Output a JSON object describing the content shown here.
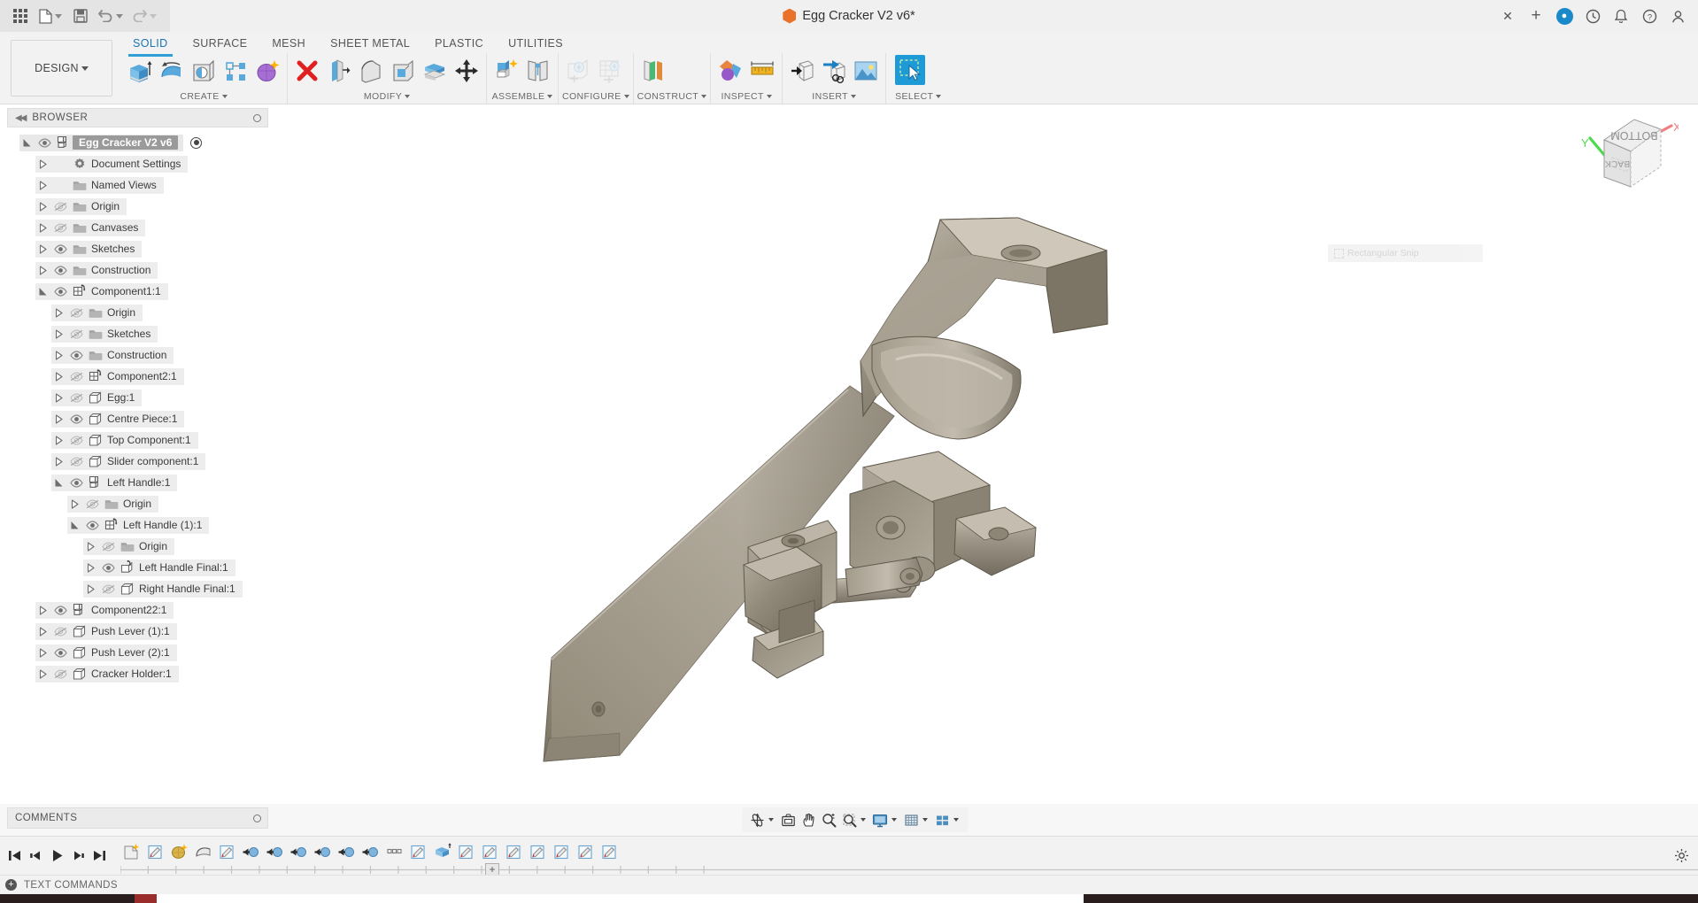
{
  "titlebar": {
    "document_title": "Egg Cracker V2 v6*",
    "left_buttons": [
      {
        "name": "app-grid",
        "icon": "grid-icon"
      },
      {
        "name": "new-file",
        "icon": "file-icon"
      },
      {
        "name": "save",
        "icon": "save-icon"
      },
      {
        "name": "undo",
        "icon": "undo-icon"
      },
      {
        "name": "redo",
        "icon": "redo-icon"
      }
    ],
    "right_buttons": [
      {
        "name": "close-tab",
        "icon": "close-icon",
        "label": "✕"
      },
      {
        "name": "new-tab",
        "icon": "plus-icon",
        "label": "+"
      },
      {
        "name": "extensions",
        "icon": "extensions-icon"
      },
      {
        "name": "job-status",
        "icon": "clock-icon"
      },
      {
        "name": "notifications",
        "icon": "bell-icon"
      },
      {
        "name": "help",
        "icon": "help-icon"
      },
      {
        "name": "account",
        "icon": "user-icon"
      }
    ]
  },
  "ribbon": {
    "workspace_label": "DESIGN",
    "tabs": [
      {
        "label": "SOLID",
        "active": true
      },
      {
        "label": "SURFACE",
        "active": false
      },
      {
        "label": "MESH",
        "active": false
      },
      {
        "label": "SHEET METAL",
        "active": false
      },
      {
        "label": "PLASTIC",
        "active": false
      },
      {
        "label": "UTILITIES",
        "active": false
      }
    ],
    "panels": [
      {
        "label": "CREATE",
        "has_dropdown": true
      },
      {
        "label": "MODIFY",
        "has_dropdown": true
      },
      {
        "label": "ASSEMBLE",
        "has_dropdown": true
      },
      {
        "label": "CONFIGURE",
        "has_dropdown": true
      },
      {
        "label": "CONSTRUCT",
        "has_dropdown": true
      },
      {
        "label": "INSPECT",
        "has_dropdown": true
      },
      {
        "label": "INSERT",
        "has_dropdown": true
      },
      {
        "label": "SELECT",
        "has_dropdown": true
      }
    ]
  },
  "browser": {
    "title": "BROWSER",
    "tree": [
      {
        "label": "Egg Cracker V2 v6",
        "indent": 0,
        "expander": "expanded",
        "eye": "visible",
        "icon": "component-icon",
        "root": true
      },
      {
        "label": "Document Settings",
        "indent": 1,
        "expander": "collapsed",
        "eye": "none",
        "icon": "gear-icon"
      },
      {
        "label": "Named Views",
        "indent": 1,
        "expander": "collapsed",
        "eye": "none",
        "icon": "folder-icon"
      },
      {
        "label": "Origin",
        "indent": 1,
        "expander": "collapsed",
        "eye": "hidden",
        "icon": "folder-icon"
      },
      {
        "label": "Canvases",
        "indent": 1,
        "expander": "collapsed",
        "eye": "hidden",
        "icon": "folder-icon"
      },
      {
        "label": "Sketches",
        "indent": 1,
        "expander": "collapsed",
        "eye": "visible",
        "icon": "folder-icon"
      },
      {
        "label": "Construction",
        "indent": 1,
        "expander": "collapsed",
        "eye": "visible",
        "icon": "folder-icon"
      },
      {
        "label": "Component1:1",
        "indent": 1,
        "expander": "expanded",
        "eye": "visible",
        "icon": "subcomponent-icon"
      },
      {
        "label": "Origin",
        "indent": 2,
        "expander": "collapsed",
        "eye": "hidden",
        "icon": "folder-icon"
      },
      {
        "label": "Sketches",
        "indent": 2,
        "expander": "collapsed",
        "eye": "hidden",
        "icon": "folder-icon"
      },
      {
        "label": "Construction",
        "indent": 2,
        "expander": "collapsed",
        "eye": "visible",
        "icon": "folder-icon"
      },
      {
        "label": "Component2:1",
        "indent": 2,
        "expander": "collapsed",
        "eye": "hidden",
        "icon": "subcomponent-icon"
      },
      {
        "label": "Egg:1",
        "indent": 2,
        "expander": "collapsed",
        "eye": "hidden",
        "icon": "body-icon"
      },
      {
        "label": "Centre Piece:1",
        "indent": 2,
        "expander": "collapsed",
        "eye": "visible",
        "icon": "body-icon"
      },
      {
        "label": "Top Component:1",
        "indent": 2,
        "expander": "collapsed",
        "eye": "hidden",
        "icon": "body-icon"
      },
      {
        "label": "Slider component:1",
        "indent": 2,
        "expander": "collapsed",
        "eye": "hidden",
        "icon": "body-icon"
      },
      {
        "label": "Left Handle:1",
        "indent": 2,
        "expander": "expanded",
        "eye": "visible",
        "icon": "component-icon"
      },
      {
        "label": "Origin",
        "indent": 3,
        "expander": "collapsed",
        "eye": "hidden",
        "icon": "folder-icon"
      },
      {
        "label": "Left Handle (1):1",
        "indent": 3,
        "expander": "expanded",
        "eye": "visible",
        "icon": "subcomponent-icon"
      },
      {
        "label": "Origin",
        "indent": 4,
        "expander": "collapsed",
        "eye": "hidden",
        "icon": "folder-icon"
      },
      {
        "label": "Left Handle Final:1",
        "indent": 4,
        "expander": "collapsed",
        "eye": "visible",
        "icon": "anchored-body-icon"
      },
      {
        "label": "Right Handle Final:1",
        "indent": 4,
        "expander": "collapsed",
        "eye": "hidden",
        "icon": "body-icon"
      },
      {
        "label": "Component22:1",
        "indent": 1,
        "expander": "collapsed",
        "eye": "visible",
        "icon": "component-icon"
      },
      {
        "label": "Push Lever (1):1",
        "indent": 1,
        "expander": "collapsed",
        "eye": "hidden",
        "icon": "body-icon"
      },
      {
        "label": "Push Lever (2):1",
        "indent": 1,
        "expander": "collapsed",
        "eye": "visible",
        "icon": "body-icon"
      },
      {
        "label": "Cracker Holder:1",
        "indent": 1,
        "expander": "collapsed",
        "eye": "hidden",
        "icon": "body-icon"
      }
    ]
  },
  "canvas": {
    "tooltip_ghost": "Rectangular Snip",
    "viewcube": {
      "top_face": "BOTTOM",
      "front_face": "BACK",
      "axis_x": "X",
      "axis_y": "Y"
    }
  },
  "viewbar": {
    "buttons": [
      {
        "name": "orbit-tool",
        "icon": "orbit-icon",
        "dropdown": true
      },
      {
        "name": "look-at-tool",
        "icon": "look-at-icon",
        "dropdown": false
      },
      {
        "name": "pan-tool",
        "icon": "hand-icon",
        "dropdown": false
      },
      {
        "name": "zoom-tool",
        "icon": "zoom-icon",
        "dropdown": false
      },
      {
        "name": "zoom-window-tool",
        "icon": "zoom-window-icon",
        "dropdown": true
      },
      {
        "name": "display-settings",
        "icon": "monitor-icon",
        "dropdown": true
      },
      {
        "name": "grid-and-snaps",
        "icon": "grid-icon",
        "dropdown": true
      },
      {
        "name": "viewports",
        "icon": "viewports-icon",
        "dropdown": true
      }
    ]
  },
  "comments": {
    "title": "COMMENTS"
  },
  "timeline": {
    "playback": [
      "skip-to-start",
      "step-back",
      "play",
      "step-forward",
      "skip-to-end"
    ],
    "feature_count": 21,
    "marker": "+"
  },
  "statusbar": {
    "text_commands_label": "TEXT COMMANDS"
  },
  "colors": {
    "accent_blue": "#2f9fd8",
    "ribbon_bg": "#f2f2f2",
    "titlebar_bg": "#f0f0f0",
    "canvas_bg": "#ffffff",
    "tree_row_bg": "#ededed",
    "root_label_bg": "#9a9a9a",
    "model_grey": "#8a8276",
    "axis_x_red": "#f08080",
    "axis_y_green": "#4ddb4d",
    "orange_logo": "#e8722a"
  }
}
